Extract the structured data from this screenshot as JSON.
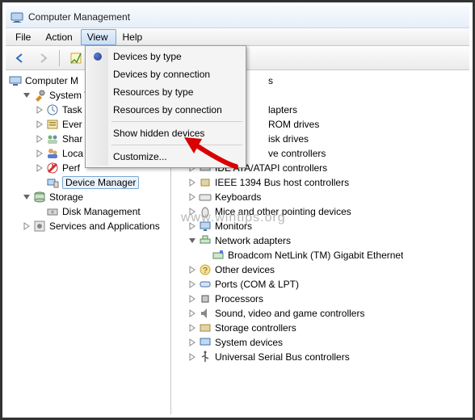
{
  "window": {
    "title": "Computer Management"
  },
  "menubar": {
    "file": "File",
    "action": "Action",
    "view": "View",
    "help": "Help"
  },
  "view_menu": {
    "devices_by_type": "Devices by type",
    "devices_by_connection": "Devices by connection",
    "resources_by_type": "Resources by type",
    "resources_by_connection": "Resources by connection",
    "show_hidden": "Show hidden devices",
    "customize": "Customize..."
  },
  "left_tree": {
    "root": "Computer M",
    "system_tools": "System T",
    "task": "Task",
    "event": "Ever",
    "shared": "Shar",
    "local": "Loca",
    "perf": "Perf",
    "device_manager": "Device Manager",
    "storage": "Storage",
    "disk_mgmt": "Disk Management",
    "services": "Services and Applications"
  },
  "right_tree": {
    "root_partial": "s",
    "display_adapters": "lapters",
    "cdrom": "ROM drives",
    "disk_drives": "isk drives",
    "floppy_ctrl": "ve controllers",
    "ide": "IDE ATA/ATAPI controllers",
    "ieee1394": "IEEE 1394 Bus host controllers",
    "keyboards": "Keyboards",
    "mice": "Mice and other pointing devices",
    "monitors": "Monitors",
    "net_adapters": "Network adapters",
    "broadcom": "Broadcom NetLink (TM) Gigabit Ethernet",
    "other": "Other devices",
    "ports": "Ports (COM & LPT)",
    "processors": "Processors",
    "sound": "Sound, video and game controllers",
    "storage_ctrl": "Storage controllers",
    "sysdev": "System devices",
    "usb": "Universal Serial Bus controllers"
  },
  "watermark": "www.wintips.org"
}
